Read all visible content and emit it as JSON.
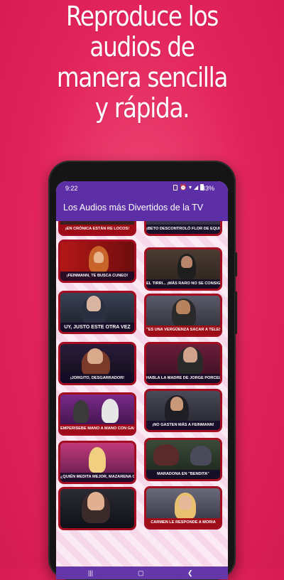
{
  "headline": [
    "Reproduce los",
    "audios de",
    "manera sencilla",
    "y rápida."
  ],
  "status_bar": {
    "time": "9:22",
    "battery": "33%"
  },
  "app_bar": {
    "title": "Los Audios más Divertidos de la TV"
  },
  "colors": {
    "background": "#e3245c",
    "app_bar": "#5d2fa6",
    "tile_border": "#a50d20"
  },
  "tiles": [
    {
      "caption": "¡EN CRÓNICA ESTÁN RE LOCOS!"
    },
    {
      "caption": "¡BETO DESCONTROLÓ FLOR DE EQUIPO!"
    },
    {
      "caption": "¡FEINMANN, TE BUSCA CUNEO!"
    },
    {
      "caption": "EL TIRRI... ¡MÁS RARO NO SE CONSIGUE!"
    },
    {
      "caption": "UY, JUSTO ESTE OTRA VEZ"
    },
    {
      "caption": "\"ES UNA VERGÜENZA SACAR A TELESHOW\""
    },
    {
      "caption": "¡JORGITO, DESGARRADOR!"
    },
    {
      "caption": "HABLA LA MADRE DE JORGE PORCEL"
    },
    {
      "caption": "EMPERISEBE MANO A MANO CON GALLARDO"
    },
    {
      "caption": "¡NO GASTEN MÁS A FEINMANN!"
    },
    {
      "caption": "¿QUIÉN MEDITA MEJOR, MAZARENA O CUNEO?"
    },
    {
      "caption": "MARADONA EN \"BENDITA\""
    },
    {
      "caption": ""
    },
    {
      "caption": "CARMEN LE RESPONDE A MORIA"
    }
  ],
  "navigation": {
    "recent": "recent-apps-icon",
    "home": "home-icon",
    "back": "back-icon"
  }
}
